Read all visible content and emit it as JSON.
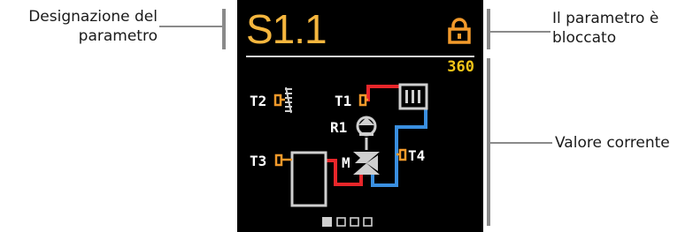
{
  "callouts": {
    "left": [
      "Designazione del",
      "parametro"
    ],
    "right_top": [
      "Il parametro è",
      "bloccato"
    ],
    "right_mid": "Valore corrente"
  },
  "screen": {
    "title": "S1.1",
    "value": "360",
    "lock_icon": "lock-icon",
    "sensors": {
      "t1": "T1",
      "t2": "T2",
      "t3": "T3",
      "t4": "T4",
      "r1": "R1",
      "m": "M"
    },
    "pages": {
      "total": 4,
      "active": 1
    }
  },
  "colors": {
    "title": "#f5b63e",
    "value": "#f5c518",
    "lock": "#f39a2b",
    "sensor_connector": "#f39a2b",
    "hot_pipe": "#e8262a",
    "cold_pipe": "#3a8fe0",
    "equipment": "#cfcfcf",
    "callout_bar": "#8a8a8a"
  }
}
